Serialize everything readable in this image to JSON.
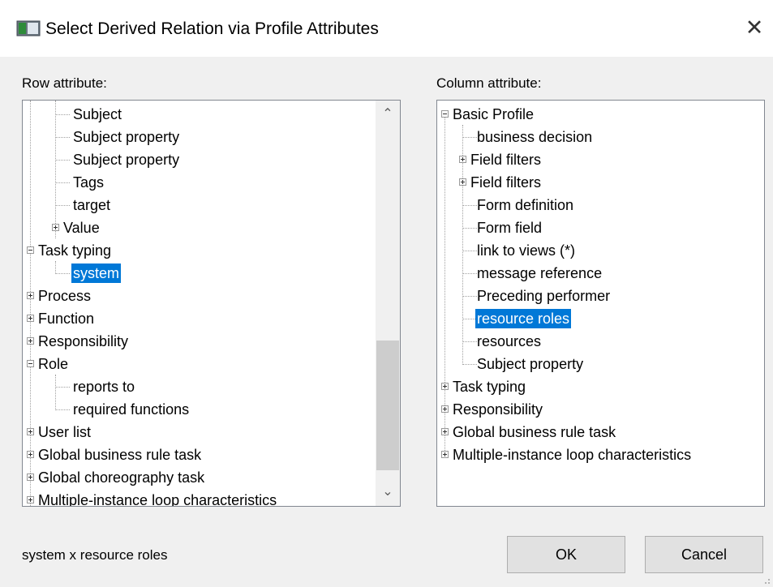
{
  "dialog": {
    "title": "Select Derived Relation via Profile Attributes",
    "close_glyph": "✕"
  },
  "row_attribute": {
    "label": "Row attribute:",
    "items": [
      {
        "label": "Subject"
      },
      {
        "label": "Subject property"
      },
      {
        "label": "Subject property"
      },
      {
        "label": "Tags"
      },
      {
        "label": "target"
      },
      {
        "label": "Value"
      },
      {
        "label": "Task typing"
      },
      {
        "label": "system"
      },
      {
        "label": "Process"
      },
      {
        "label": "Function"
      },
      {
        "label": "Responsibility"
      },
      {
        "label": "Role"
      },
      {
        "label": "reports to"
      },
      {
        "label": "required functions"
      },
      {
        "label": "User list"
      },
      {
        "label": "Global business rule task"
      },
      {
        "label": "Global choreography task"
      },
      {
        "label": "Multiple-instance loop characteristics"
      }
    ],
    "selected": "system"
  },
  "column_attribute": {
    "label": "Column attribute:",
    "items": [
      {
        "label": "Basic Profile"
      },
      {
        "label": "business decision"
      },
      {
        "label": "Field filters"
      },
      {
        "label": "Field filters"
      },
      {
        "label": "Form definition"
      },
      {
        "label": "Form field"
      },
      {
        "label": "link to views (*)"
      },
      {
        "label": "message reference"
      },
      {
        "label": "Preceding performer"
      },
      {
        "label": "resource roles"
      },
      {
        "label": "resources"
      },
      {
        "label": "Subject property"
      },
      {
        "label": "Task typing"
      },
      {
        "label": "Responsibility"
      },
      {
        "label": "Global business rule task"
      },
      {
        "label": "Multiple-instance loop characteristics"
      }
    ],
    "selected": "resource roles"
  },
  "footer": {
    "status": "system x resource roles",
    "ok_label": "OK",
    "cancel_label": "Cancel"
  },
  "colors": {
    "selection": "#0078d7",
    "window_bg": "#f0f0f0",
    "tree_bg": "#ffffff"
  }
}
